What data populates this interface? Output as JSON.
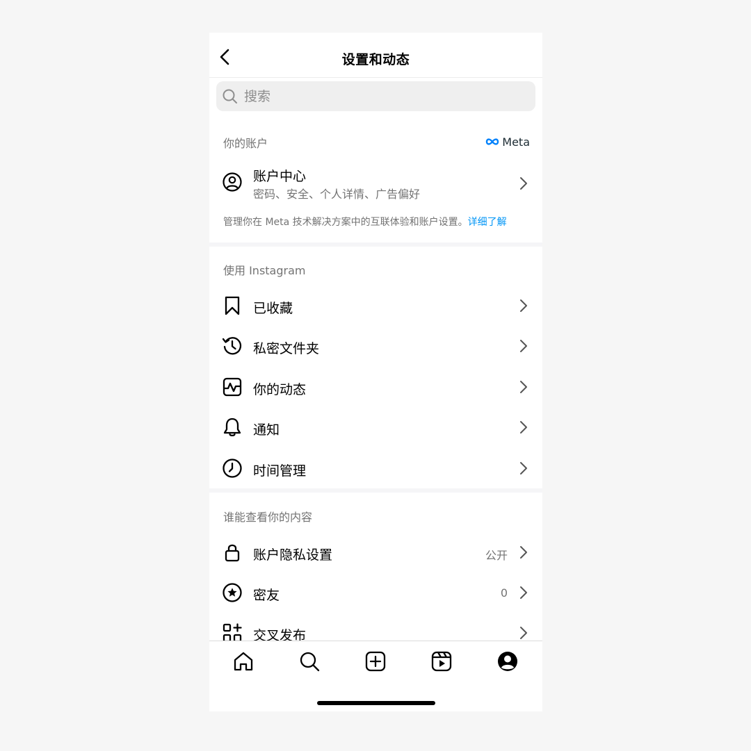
{
  "header": {
    "title": "设置和动态"
  },
  "search": {
    "placeholder": "搜索",
    "value": ""
  },
  "account_section": {
    "label": "你的账户",
    "meta_logo_text": "Meta",
    "account_center": {
      "title": "账户中心",
      "subtitle": "密码、安全、个人详情、广告偏好"
    },
    "note": "管理你在 Meta 技术解决方案中的互联体验和账户设置。",
    "note_link": "详细了解"
  },
  "instagram_section": {
    "label": "使用 Instagram",
    "items": [
      {
        "label": "已收藏",
        "icon": "bookmark-icon"
      },
      {
        "label": "私密文件夹",
        "icon": "archive-icon"
      },
      {
        "label": "你的动态",
        "icon": "activity-icon"
      },
      {
        "label": "通知",
        "icon": "bell-icon"
      },
      {
        "label": "时间管理",
        "icon": "clock-icon"
      }
    ]
  },
  "visibility_section": {
    "label": "谁能查看你的内容",
    "items": [
      {
        "label": "账户隐私设置",
        "value": "公开",
        "icon": "lock-icon"
      },
      {
        "label": "密友",
        "value": "0",
        "icon": "star-circle-icon"
      },
      {
        "label": "交叉发布",
        "icon": "grid-add-icon"
      }
    ]
  },
  "tabbar": [
    "home-icon",
    "search-icon",
    "create-icon",
    "reels-icon",
    "profile-icon"
  ]
}
